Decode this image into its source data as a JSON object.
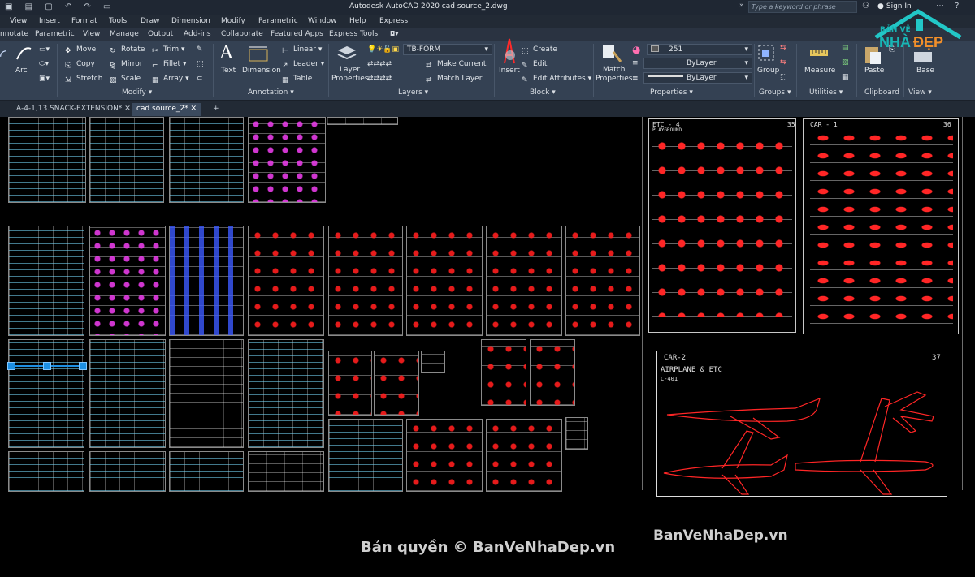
{
  "titlebar": {
    "app_title": "Autodesk AutoCAD 2020    cad source_2.dwg",
    "search_placeholder": "Type a keyword or phrase",
    "sign_in": "Sign In"
  },
  "menubar": {
    "items": [
      "View",
      "Insert",
      "Format",
      "Tools",
      "Draw",
      "Dimension",
      "Modify",
      "Parametric",
      "Window",
      "Help",
      "Express"
    ]
  },
  "ribbon_tabs": {
    "items": [
      "nnotate",
      "Parametric",
      "View",
      "Manage",
      "Output",
      "Add-ins",
      "Collaborate",
      "Featured Apps",
      "Express Tools"
    ]
  },
  "ribbon": {
    "draw": {
      "arc": "Arc"
    },
    "modify": {
      "title": "Modify",
      "move": "Move",
      "rotate": "Rotate",
      "trim": "Trim",
      "copy": "Copy",
      "mirror": "Mirror",
      "fillet": "Fillet",
      "stretch": "Stretch",
      "scale": "Scale",
      "array": "Array"
    },
    "annotation": {
      "title": "Annotation",
      "text": "Text",
      "dimension": "Dimension",
      "linear": "Linear",
      "leader": "Leader",
      "table": "Table"
    },
    "layers": {
      "title": "Layers",
      "layer_properties_1": "Layer",
      "layer_properties_2": "Properties",
      "current_layer": "TB-FORM",
      "make_current": "Make Current",
      "match_layer": "Match Layer"
    },
    "block": {
      "title": "Block",
      "insert": "Insert",
      "create": "Create",
      "edit": "Edit",
      "edit_attributes": "Edit Attributes"
    },
    "properties": {
      "title": "Properties",
      "match_1": "Match",
      "match_2": "Properties",
      "color_value": "251",
      "linetype": "ByLayer",
      "lineweight": "ByLayer"
    },
    "groups": {
      "title": "Groups",
      "group": "Group"
    },
    "utilities": {
      "title": "Utilities",
      "measure": "Measure"
    },
    "clipboard": {
      "title": "Clipboard",
      "paste": "Paste"
    },
    "view": {
      "title": "View",
      "base": "Base"
    }
  },
  "file_tabs": {
    "tab1": "A-4-1,13.SNACK-EXTENSION*",
    "tab2": "cad source_2*"
  },
  "drawing": {
    "sheet_etc": "ETC - 4",
    "sheet_etc_num": "35",
    "sheet_etc_sub": "PLAYGROUND",
    "sheet_car1": "CAR - 1",
    "sheet_car1_num": "36",
    "sheet_car2": "CAR-2",
    "sheet_car2_num": "37",
    "sheet_car2_sub": "AIRPLANE & ETC",
    "sheet_car2_code": "C-401"
  },
  "watermark": {
    "left": "Bản quyền © BanVeNhaDep.vn",
    "right": "BanVeNhaDep.vn",
    "logo_top": "BẢN VẼ",
    "logo_main_1": "NHÀ",
    "logo_main_2": "ĐẸP"
  },
  "colors": {
    "ribbon_bg": "#344153",
    "red_lines": "#ff2626",
    "cyan_lines": "#59d6ff",
    "grip_blue": "#1d8fe3"
  }
}
